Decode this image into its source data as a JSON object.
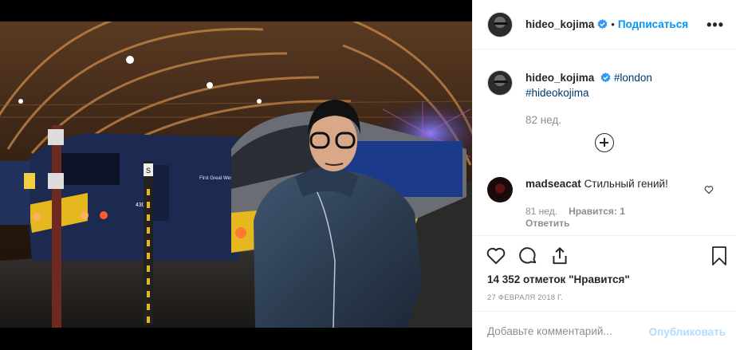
{
  "header": {
    "username": "hideo_kojima",
    "separator": "•",
    "follow_label": "Подписаться",
    "more_label": "•••"
  },
  "caption": {
    "username": "hideo_kojima",
    "tag1": "#london",
    "tag2": "#hideokojima",
    "time": "82 нед."
  },
  "comment": {
    "username": "madseacat",
    "text": "Стильный гений!",
    "time": "81 нед.",
    "likes": "Нравится: 1",
    "reply": "Ответить"
  },
  "stats": {
    "likes": "14 352 отметок \"Нравится\"",
    "date": "27 ФЕВРАЛЯ 2018 Г."
  },
  "composer": {
    "placeholder": "Добавьте комментарий...",
    "post_label": "Опубликовать"
  },
  "photo": {
    "train_number": "430 4",
    "brand_text": "First Great Western",
    "sign_letter": "S"
  },
  "colors": {
    "accent": "#0095f6",
    "post_disabled": "#b3dbff",
    "muted": "#8e8e8e",
    "verified": "#3897f0"
  },
  "icons": [
    "verified-icon",
    "add-comment-icon",
    "heart-icon",
    "comment-icon",
    "share-icon",
    "bookmark-icon"
  ]
}
